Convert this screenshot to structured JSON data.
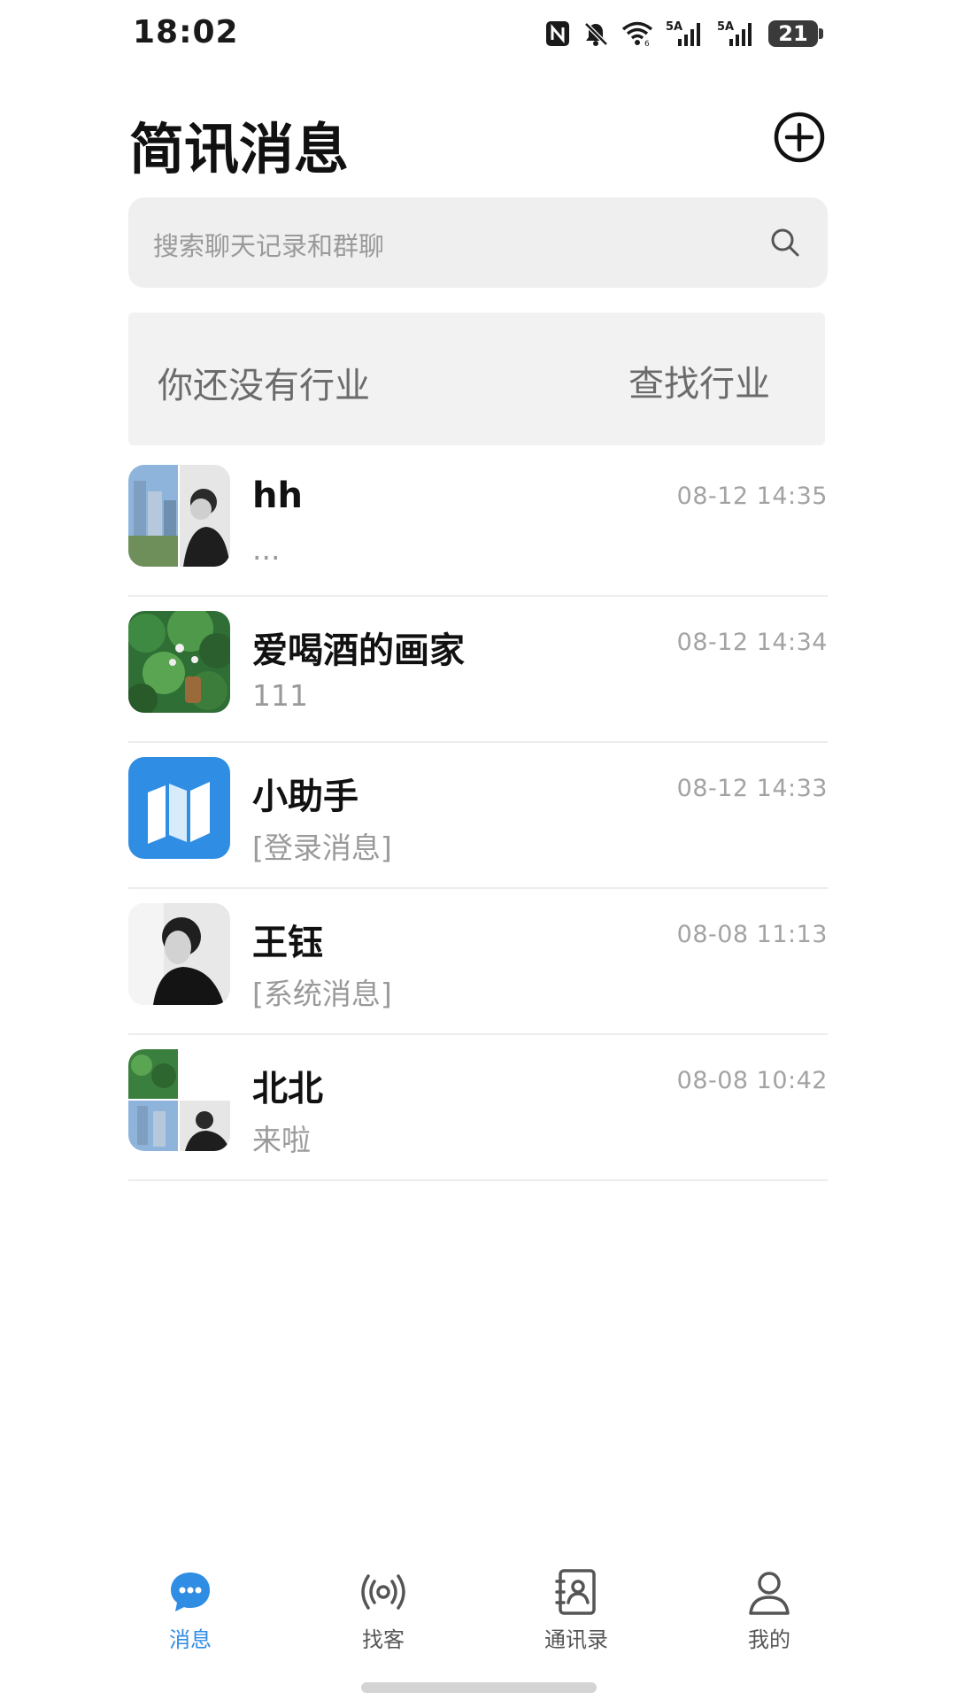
{
  "status_bar": {
    "time": "18:02",
    "network_1": "5A",
    "network_2": "5A",
    "battery": "21",
    "icons": [
      "nfc-icon",
      "mute-icon",
      "wifi-icon",
      "signal-icon",
      "signal-icon",
      "battery-icon"
    ]
  },
  "header": {
    "title": "简讯消息",
    "add_icon": "plus-circle-icon"
  },
  "search": {
    "placeholder": "搜索聊天记录和群聊",
    "icon": "search-icon"
  },
  "industry_banner": {
    "text": "你还没有行业",
    "link": "查找行业"
  },
  "conversations": [
    {
      "name": "hh",
      "preview": "...",
      "time": "08-12 14:35",
      "avatar": "group-avatar"
    },
    {
      "name": "爱喝酒的画家",
      "preview": "111",
      "time": "08-12 14:34",
      "avatar": "nature-avatar"
    },
    {
      "name": "小助手",
      "preview": "[登录消息]",
      "time": "08-12 14:33",
      "avatar": "assistant-avatar"
    },
    {
      "name": "王钰",
      "preview": "[系统消息]",
      "time": "08-08 11:13",
      "avatar": "person-avatar"
    },
    {
      "name": "北北",
      "preview": "来啦",
      "time": "08-08 10:42",
      "avatar": "group-avatar"
    }
  ],
  "tabs": [
    {
      "label": "消息",
      "icon": "chat-bubble-icon",
      "active": true
    },
    {
      "label": "找客",
      "icon": "broadcast-icon",
      "active": false
    },
    {
      "label": "通讯录",
      "icon": "contacts-book-icon",
      "active": false
    },
    {
      "label": "我的",
      "icon": "person-icon",
      "active": false
    }
  ],
  "colors": {
    "accent": "#2f8de4",
    "assistant_bg": "#2f8de4",
    "search_bg": "#efefef",
    "banner_bg": "#f2f2f2"
  }
}
